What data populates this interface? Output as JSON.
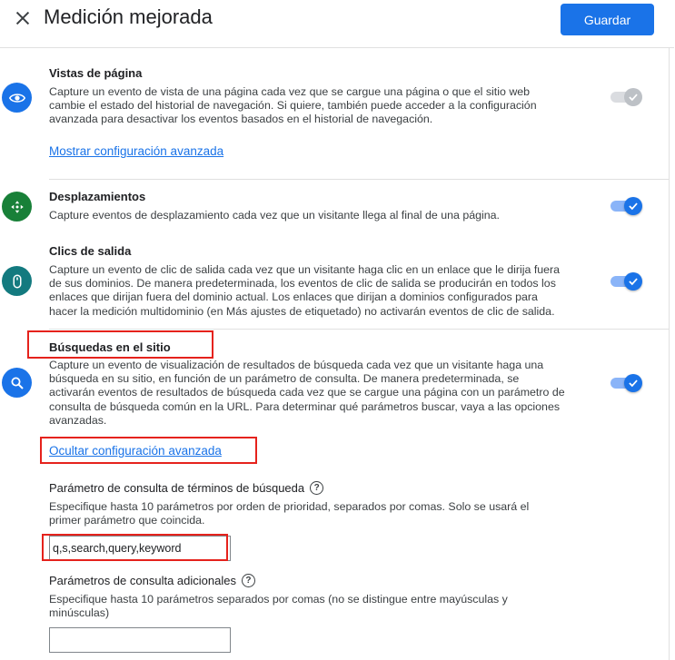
{
  "header": {
    "title": "Medición mejorada",
    "save_label": "Guardar"
  },
  "sections": [
    {
      "icon": "eye-icon",
      "title": "Vistas de página",
      "description": "Capture un evento de vista de una página cada vez que se cargue una página o que el sitio web cambie el estado del historial de navegación. Si quiere, también puede acceder a la configuración avanzada para desactivar los eventos basados en el historial de navegación.",
      "link": "Mostrar configuración avanzada",
      "toggle": "on-disabled"
    },
    {
      "icon": "scroll-icon",
      "title": "Desplazamientos",
      "description": "Capture eventos de desplazamiento cada vez que un visitante llega al final de una página.",
      "toggle": "on"
    },
    {
      "icon": "mouse-icon",
      "title": "Clics de salida",
      "description": "Capture un evento de clic de salida cada vez que un visitante haga clic en un enlace que le dirija fuera de sus dominios. De manera predeterminada, los eventos de clic de salida se producirán en todos los enlaces que dirijan fuera del dominio actual. Los enlaces que dirijan a dominios configurados para hacer la medición multidominio (en Más ajustes de etiquetado) no activarán eventos de clic de salida.",
      "toggle": "on"
    },
    {
      "icon": "search-icon",
      "title": "Búsquedas en el sitio",
      "description": "Capture un evento de visualización de resultados de búsqueda cada vez que un visitante haga una búsqueda en su sitio, en función de un parámetro de consulta. De manera predeterminada, se activarán eventos de resultados de búsqueda cada vez que se cargue una página con un parámetro de consulta de búsqueda común en la URL. Para determinar qué parámetros buscar, vaya a las opciones avanzadas.",
      "link": "Ocultar configuración avanzada",
      "toggle": "on"
    }
  ],
  "search_settings": {
    "query_param_title": "Parámetro de consulta de términos de búsqueda",
    "query_param_desc": "Especifique hasta 10 parámetros por orden de prioridad, separados por comas. Solo se usará el primer parámetro que coincida.",
    "query_param_value": "q,s,search,query,keyword",
    "additional_title": "Parámetros de consulta adicionales",
    "additional_desc": "Especifique hasta 10 parámetros separados por comas (no se distingue entre mayúsculas y minúsculas)",
    "additional_value": ""
  },
  "colors": {
    "accent": "#1a73e8",
    "highlight": "#e5221c"
  }
}
